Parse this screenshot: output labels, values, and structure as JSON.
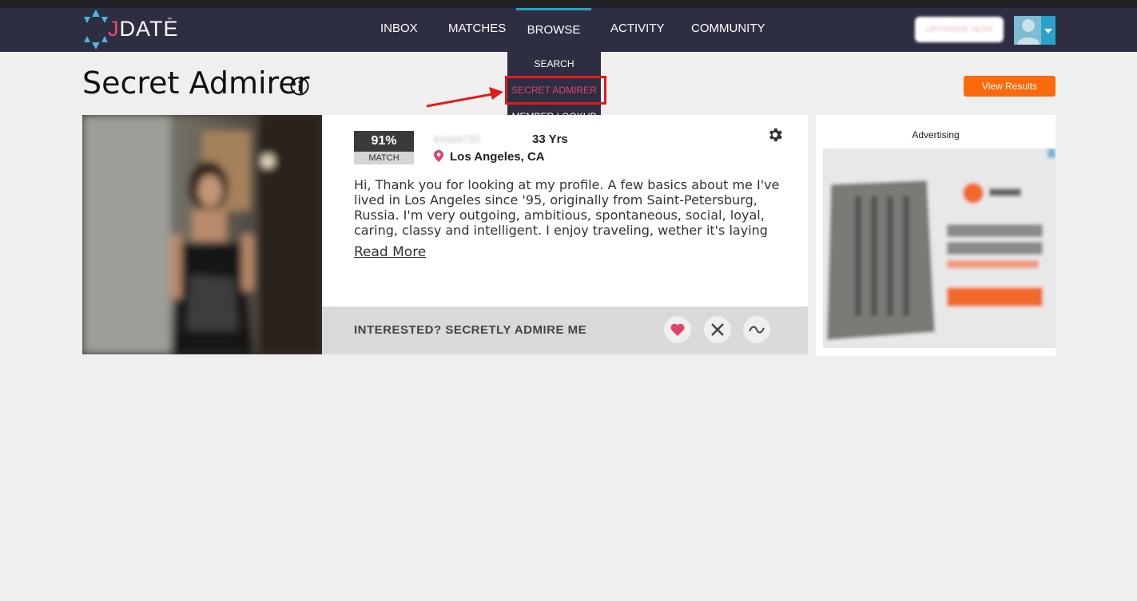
{
  "brand": {
    "logo_letter": "J",
    "logo_rest": "DATE",
    "trademark": "™"
  },
  "nav": {
    "items": [
      {
        "label": "INBOX"
      },
      {
        "label": "MATCHES"
      },
      {
        "label": "BROWSE"
      },
      {
        "label": "ACTIVITY"
      },
      {
        "label": "COMMUNITY"
      }
    ],
    "upgrade_label": "UPGRADE NOW",
    "browse_dropdown": [
      {
        "label": "SEARCH"
      },
      {
        "label": "SECRET ADMIRER"
      },
      {
        "label": "MEMBER LOOKUP"
      }
    ]
  },
  "page": {
    "title": "Secret Admirer",
    "view_results_label": "View Results"
  },
  "profile": {
    "match_percent": "91%",
    "match_label": "MATCH",
    "username": "Kristi4720",
    "age": "33 Yrs",
    "location": "Los Angeles, CA",
    "bio": "Hi, Thank you for looking at my profile. A few basics about me I've lived in Los Angeles since '95, originally from Saint-Petersburg, Russia. I'm very outgoing, ambitious, spontaneous, social, loyal, caring, classy and intelligent. I enjoy traveling, wether it's laying on",
    "read_more": "Read More",
    "interest_prompt": "INTERESTED? SECRETLY ADMIRE ME"
  },
  "ad": {
    "label": "Advertising"
  },
  "colors": {
    "navbar": "#2e2e43",
    "accent_blue": "#2aa1c9",
    "accent_pink": "#e0436a",
    "orange": "#fa6a0a",
    "highlight_red": "#e01b1b"
  }
}
